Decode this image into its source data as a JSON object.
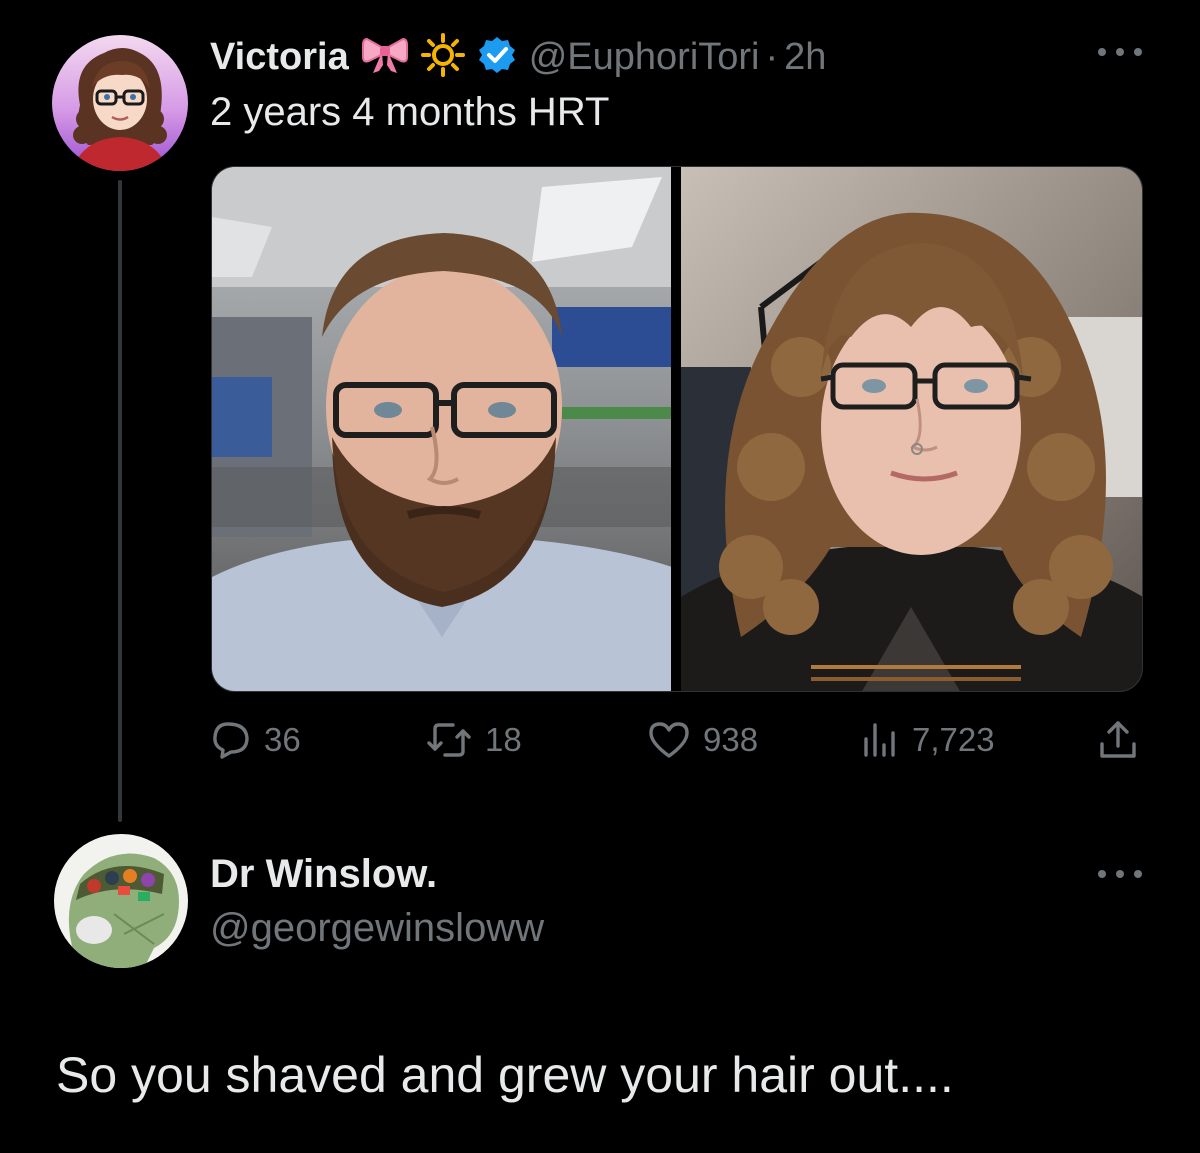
{
  "tweet": {
    "author": {
      "display_name": "Victoria",
      "emojis": [
        "ribbon-icon",
        "sun-icon"
      ],
      "verified": true,
      "handle": "@EuphoriTori",
      "separator": "·",
      "time": "2h"
    },
    "text": "2 years 4 months HRT",
    "media": [
      {
        "name": "before-photo",
        "icon": "photo-before"
      },
      {
        "name": "after-photo",
        "icon": "photo-after"
      }
    ],
    "actions": {
      "replies": "36",
      "retweets": "18",
      "likes": "938",
      "views": "7,723"
    },
    "colors": {
      "background": "#000000",
      "text": "#e7e9ea",
      "muted": "#71767b",
      "verified": "#1d9bf0"
    }
  },
  "reply": {
    "author": {
      "display_name": "Dr Winslow.",
      "handle": "@georgewinsloww"
    },
    "text": "So you shaved and grew your hair out...."
  }
}
